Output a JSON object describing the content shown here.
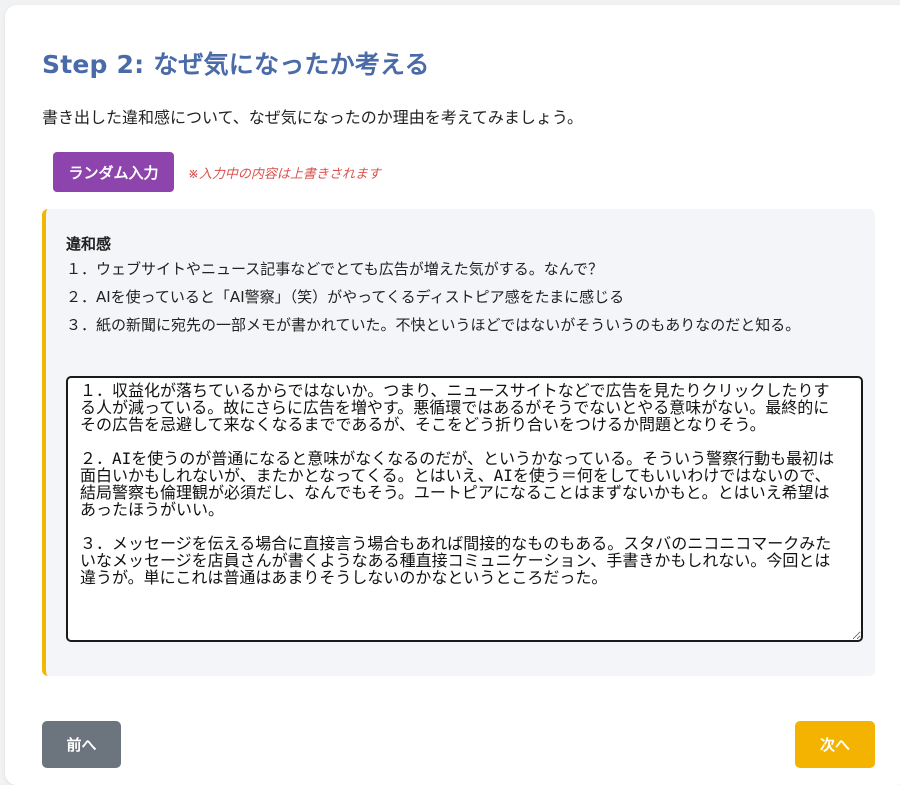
{
  "step": {
    "title": "Step 2: なぜ気になったか考える",
    "description": "書き出した違和感について、なぜ気になったのか理由を考えてみましょう。"
  },
  "random": {
    "button_label": "ランダム入力",
    "warning": "※入力中の内容は上書きされます"
  },
  "panel": {
    "heading": "違和感",
    "items": [
      "１．ウェブサイトやニュース記事などでとても広告が増えた気がする。なんで？",
      "２．AIを使っていると「AI警察」（笑）がやってくるディストピア感をたまに感じる",
      "３．紙の新聞に宛先の一部メモが書かれていた。不快というほどではないがそういうのもありなのだと知る。"
    ],
    "answer_value": "１．収益化が落ちているからではないか。つまり、ニュースサイトなどで広告を見たりクリックしたりする人が減っている。故にさらに広告を増やす。悪循環ではあるがそうでないとやる意味がない。最終的にその広告を忌避して来なくなるまでであるが、そこをどう折り合いをつけるか問題となりそう。\n\n２．AIを使うのが普通になると意味がなくなるのだが、というかなっている。そういう警察行動も最初は面白いかもしれないが、またかとなってくる。とはいえ、AIを使う＝何をしてもいいわけではないので、結局警察も倫理観が必須だし、なんでもそう。ユートピアになることはまずないかもと。とはいえ希望はあったほうがいい。\n\n３．メッセージを伝える場合に直接言う場合もあれば間接的なものもある。スタバのニコニコマークみたいなメッセージを店員さんが書くようなある種直接コミュニケーション、手書きかもしれない。今回とは違うが。単にこれは普通はあまりそうしないのかなというところだった。"
  },
  "nav": {
    "prev_label": "前へ",
    "next_label": "次へ"
  },
  "colors": {
    "title": "#4a6aa8",
    "random_button": "#8e44ad",
    "warning": "#d9534f",
    "panel_accent": "#f2b705",
    "prev_button": "#6c757d",
    "next_button": "#f5b301"
  }
}
